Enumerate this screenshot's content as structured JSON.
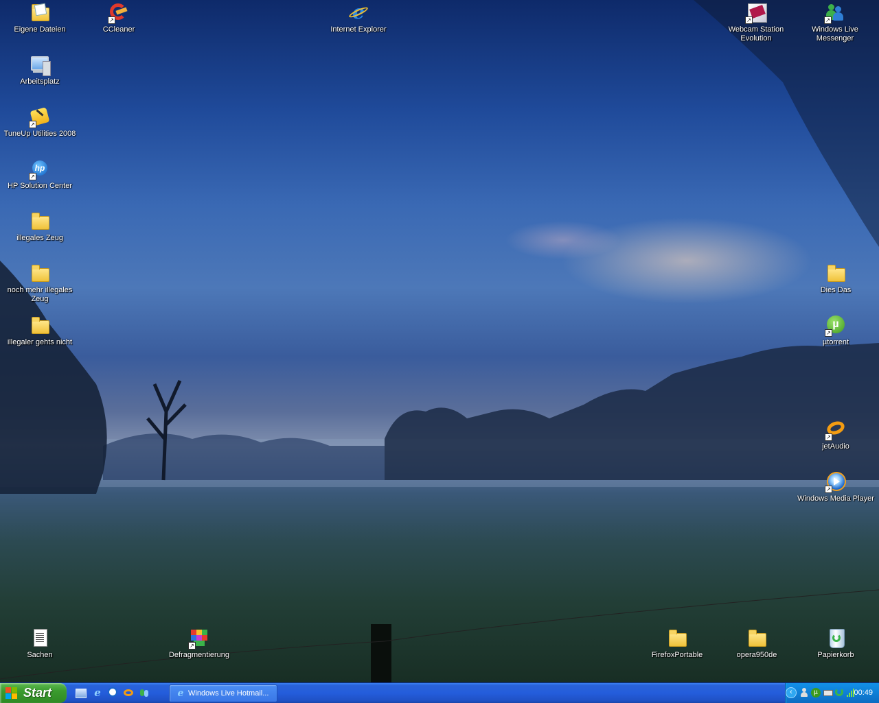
{
  "desktop": {
    "icons": {
      "eigene_dateien": "Eigene Dateien",
      "ccleaner": "CCleaner",
      "internet_explorer": "Internet Explorer",
      "webcam_station": "Webcam Station Evolution",
      "windows_live_messenger": "Windows Live Messenger",
      "arbeitsplatz": "Arbeitsplatz",
      "tuneup": "TuneUp Utilities 2008",
      "hp_solution_center": "HP Solution Center",
      "illegales_zeug": "illegales Zeug",
      "noch_mehr": "noch mehr illegales Zeug",
      "illegaler_gehts_nicht": "illegaler gehts nicht",
      "dies_das": "Dies Das",
      "utorrent": "µtorrent",
      "jetaudio": "jetAudio",
      "windows_media_player": "Windows Media Player",
      "sachen": "Sachen",
      "defragmentierung": "Defragmentierung",
      "firefoxportable": "FirefoxPortable",
      "opera950de": "opera950de",
      "papierkorb": "Papierkorb"
    }
  },
  "taskbar": {
    "start_label": "Start",
    "tasks": [
      "Windows Live Hotmail..."
    ],
    "clock": "00:49"
  },
  "colors": {
    "taskbar_blue": "#245ddb",
    "start_green": "#3a9b2e",
    "tray_blue": "#0f7fd6",
    "folder_yellow": "#f0c23a"
  }
}
